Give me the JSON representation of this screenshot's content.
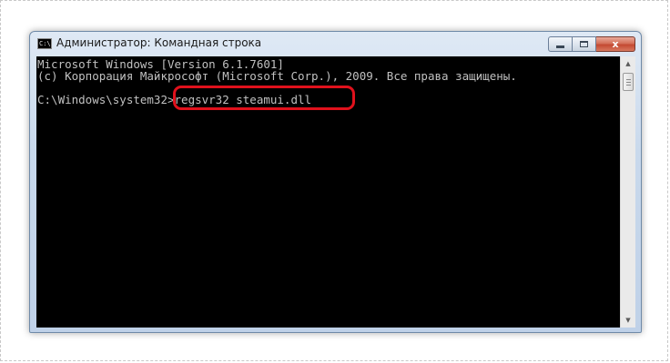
{
  "window": {
    "title": "Администратор: Командная строка",
    "icon_label": "C:\\",
    "icon": "cmd-icon"
  },
  "caption_buttons": {
    "minimize_icon": "minimize-icon",
    "maximize_icon": "maximize-icon",
    "close_label": "x"
  },
  "console": {
    "lines": [
      "Microsoft Windows [Version 6.1.7601]",
      "(c) Корпорация Майкрософт (Microsoft Corp.), 2009. Все права защищены.",
      "",
      "C:\\Windows\\system32>regsvr32 steamui.dll"
    ],
    "prompt": "C:\\Windows\\system32>",
    "command": "regsvr32 steamui.dll"
  },
  "colors": {
    "console_background": "#000000",
    "console_text": "#c0c0c0",
    "highlight": "#e0111c"
  },
  "scrollbar": {
    "up_icon": "scroll-up-arrow-icon",
    "down_icon": "scroll-down-arrow-icon"
  }
}
